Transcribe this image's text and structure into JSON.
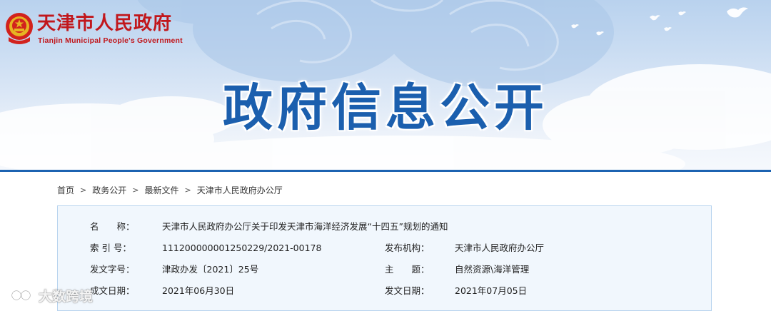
{
  "header": {
    "site_title": "天津市人民政府",
    "site_subtitle": "Tianjin Municipal People's Government",
    "hero_title": "政府信息公开"
  },
  "breadcrumb": [
    "首页",
    "政务公开",
    "最新文件",
    "天津市人民政府办公厅"
  ],
  "document_info": {
    "name_label": "名　　称：",
    "name_value": "天津市人民政府办公厅关于印发天津市海洋经济发展“十四五”规划的通知",
    "index_label": "索 引 号：",
    "index_value": "111200000001250229/2021-00178",
    "issuer_label": "发布机构：",
    "issuer_value": "天津市人民政府办公厅",
    "doc_number_label": "发文字号：",
    "doc_number_value": "津政办发〔2021〕25号",
    "subject_label": "主　　题：",
    "subject_value": "自然资源\\海洋管理",
    "created_label": "成文日期：",
    "created_value": "2021年06月30日",
    "published_label": "发文日期：",
    "published_value": "2021年07月05日"
  },
  "watermark": {
    "text": "大数跨境"
  },
  "colors": {
    "brand_red": "#c1171c",
    "hero_blue": "#1b5fae",
    "divider_blue": "#1c63b1",
    "box_bg": "#f1f7fd",
    "box_border": "#b7d3ee"
  }
}
